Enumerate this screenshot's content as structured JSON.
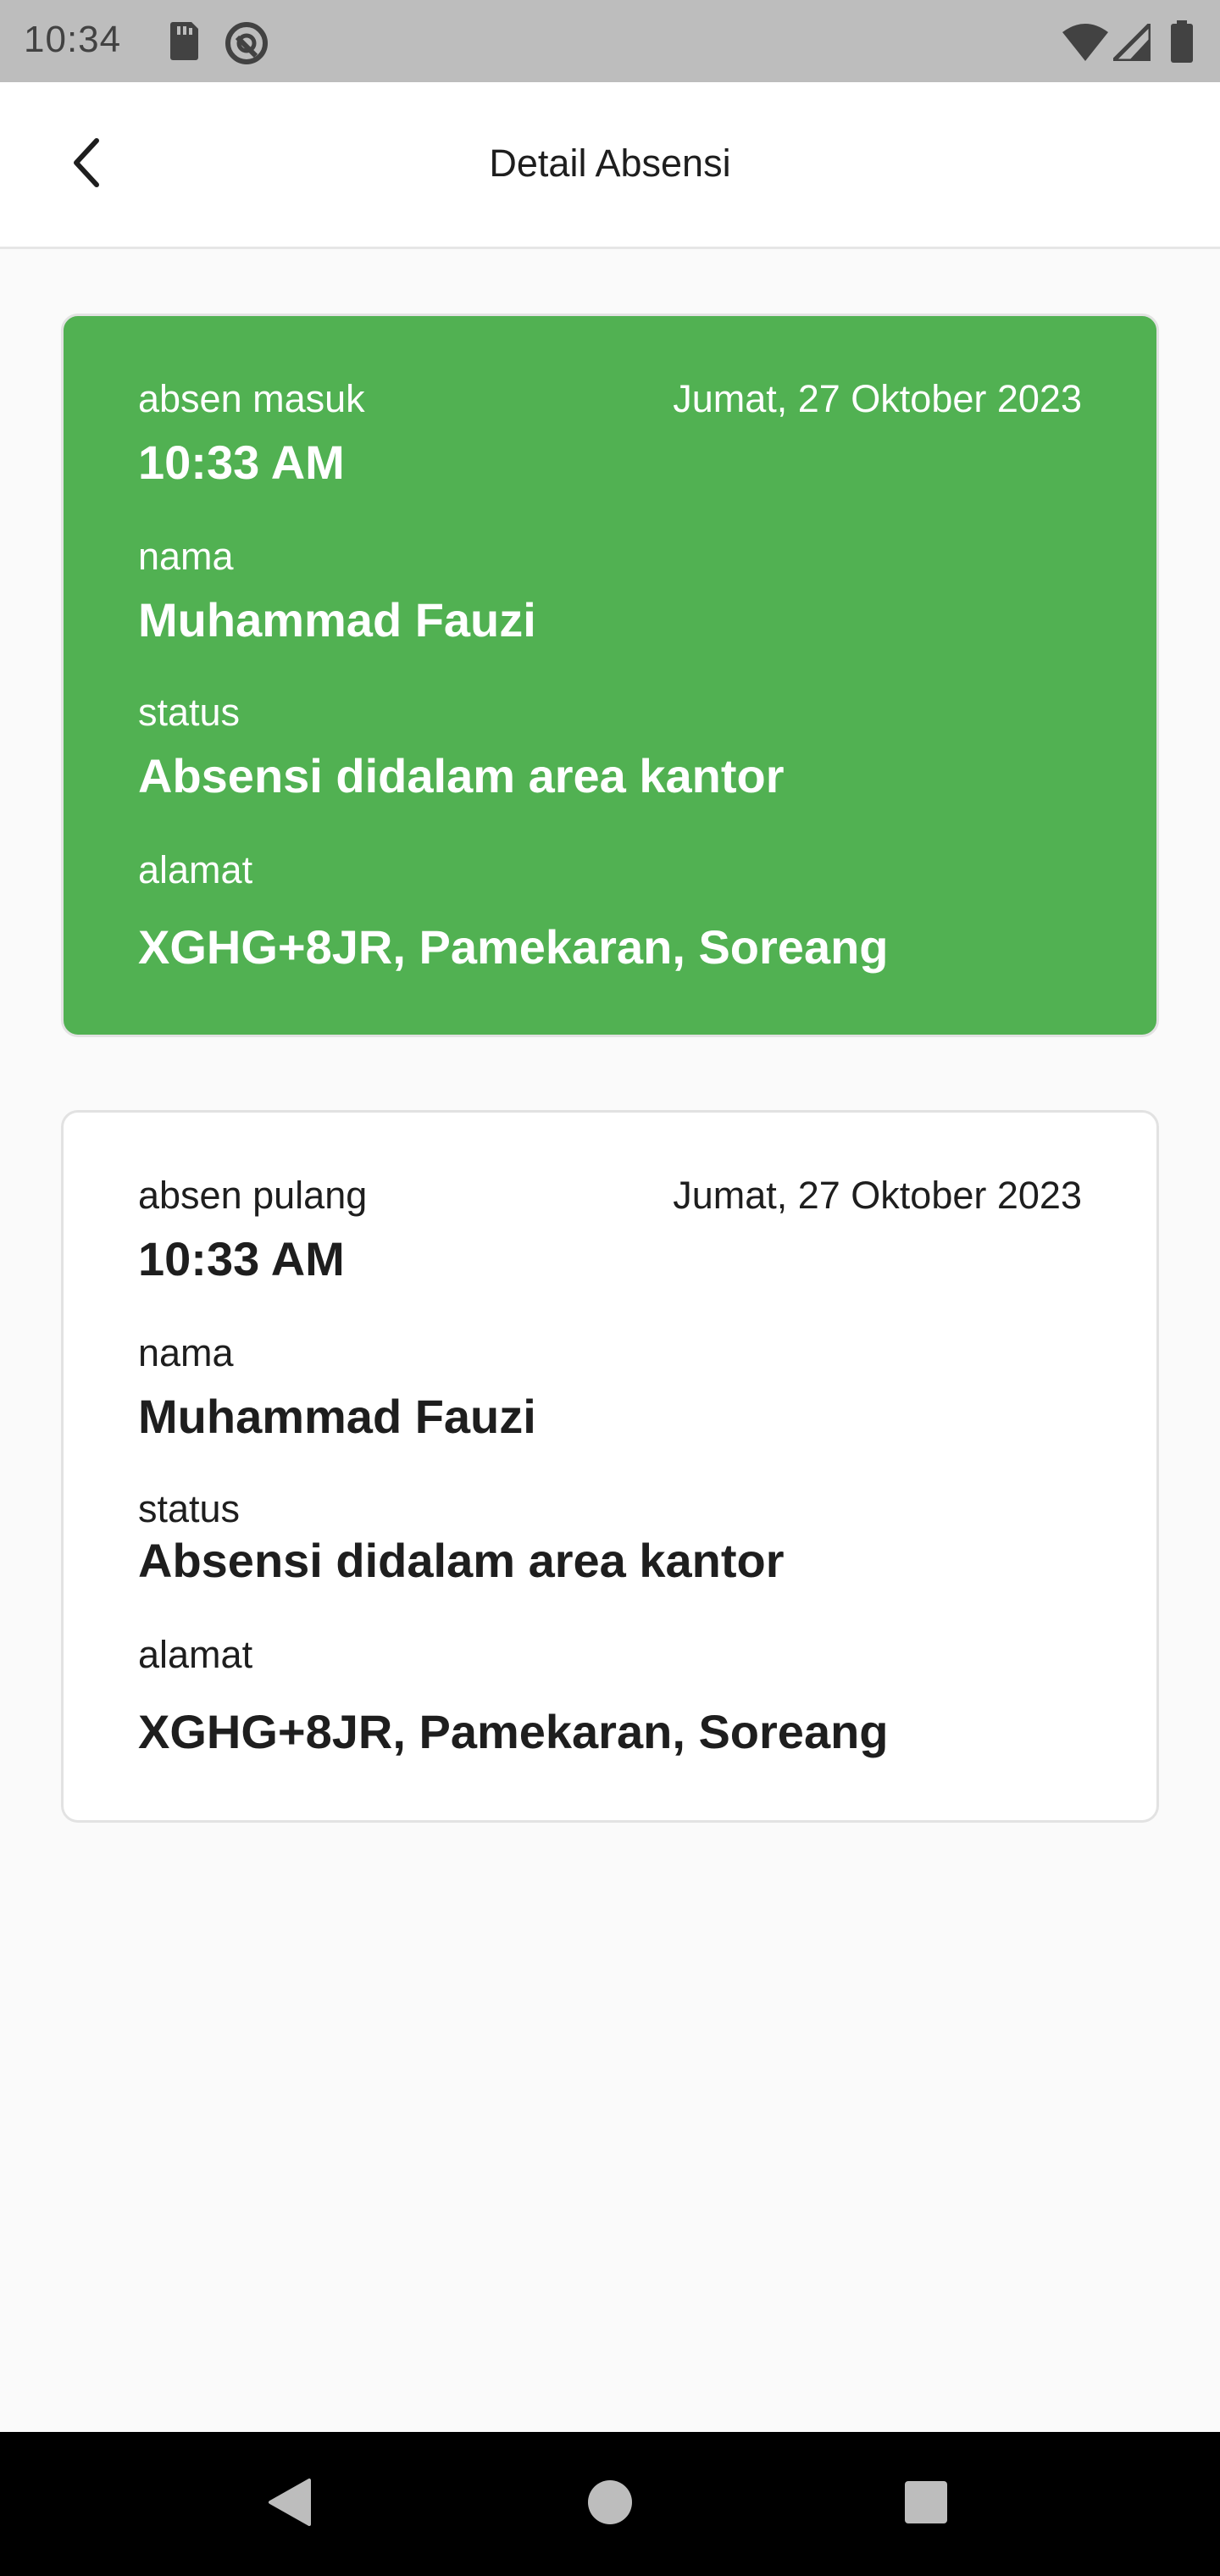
{
  "status_bar": {
    "time": "10:34",
    "icons": [
      "sd-card-icon",
      "sync-icon",
      "wifi-icon",
      "signal-icon",
      "battery-icon"
    ]
  },
  "app_bar": {
    "title": "Detail Absensi",
    "back_icon": "chevron-left-icon"
  },
  "cards": [
    {
      "type_label": "absen masuk",
      "date": "Jumat, 27 Oktober 2023",
      "time": "10:33 AM",
      "name_label": "nama",
      "name": "Muhammad Fauzi",
      "status_label": "status",
      "status": "Absensi didalam area kantor",
      "address_label": "alamat",
      "address": "XGHG+8JR, Pamekaran, Soreang",
      "background_color": "#51b152"
    },
    {
      "type_label": "absen pulang",
      "date": "Jumat, 27 Oktober 2023",
      "time": "10:33 AM",
      "name_label": "nama",
      "name": "Muhammad Fauzi",
      "status_label": "status",
      "status": "Absensi didalam area kantor",
      "address_label": "alamat",
      "address": "XGHG+8JR, Pamekaran, Soreang",
      "background_color": "#ffffff"
    }
  ],
  "nav_bar": {
    "icons": [
      "back-triangle-icon",
      "home-circle-icon",
      "recents-square-icon"
    ]
  }
}
